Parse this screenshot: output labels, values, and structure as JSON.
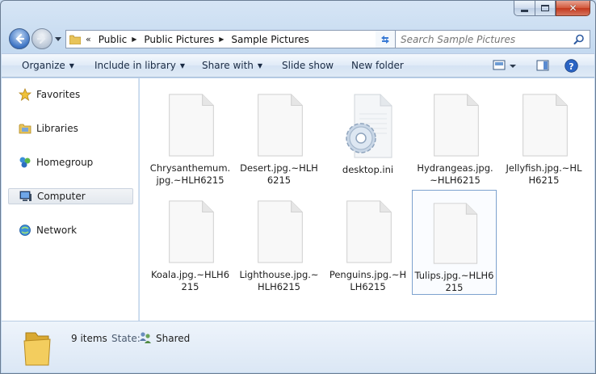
{
  "window": {
    "caption_buttons": [
      "minimize",
      "maximize",
      "close"
    ]
  },
  "address": {
    "prefix": "«",
    "crumbs": [
      "Public",
      "Public Pictures",
      "Sample Pictures"
    ]
  },
  "search": {
    "placeholder": "Search Sample Pictures"
  },
  "toolbar": {
    "organize": "Organize",
    "include_in_library": "Include in library",
    "share_with": "Share with",
    "slide_show": "Slide show",
    "new_folder": "New folder"
  },
  "nav": {
    "items": [
      {
        "label": "Favorites",
        "icon": "star-icon"
      },
      {
        "label": "Libraries",
        "icon": "libraries-icon"
      },
      {
        "label": "Homegroup",
        "icon": "homegroup-icon"
      },
      {
        "label": "Computer",
        "icon": "computer-icon"
      },
      {
        "label": "Network",
        "icon": "network-icon"
      }
    ]
  },
  "files": [
    {
      "name": "Chrysanthemum.jpg.~HLH6215",
      "icon": "blank-document-icon"
    },
    {
      "name": "Desert.jpg.~HLH6215",
      "icon": "blank-document-icon"
    },
    {
      "name": "desktop.ini",
      "icon": "settings-document-icon"
    },
    {
      "name": "Hydrangeas.jpg.~HLH6215",
      "icon": "blank-document-icon"
    },
    {
      "name": "Jellyfish.jpg.~HLH6215",
      "icon": "blank-document-icon"
    },
    {
      "name": "Koala.jpg.~HLH6215",
      "icon": "blank-document-icon"
    },
    {
      "name": "Lighthouse.jpg.~HLH6215",
      "icon": "blank-document-icon"
    },
    {
      "name": "Penguins.jpg.~HLH6215",
      "icon": "blank-document-icon"
    },
    {
      "name": "Tulips.jpg.~HLH6215",
      "icon": "blank-document-icon"
    }
  ],
  "details": {
    "count": "9 items",
    "state_label": "State:",
    "state_value": "Shared"
  },
  "colors": {
    "frame": "#c2d8ef",
    "selection_border": "#7da2ce",
    "accent_blue": "#3d74c4"
  }
}
